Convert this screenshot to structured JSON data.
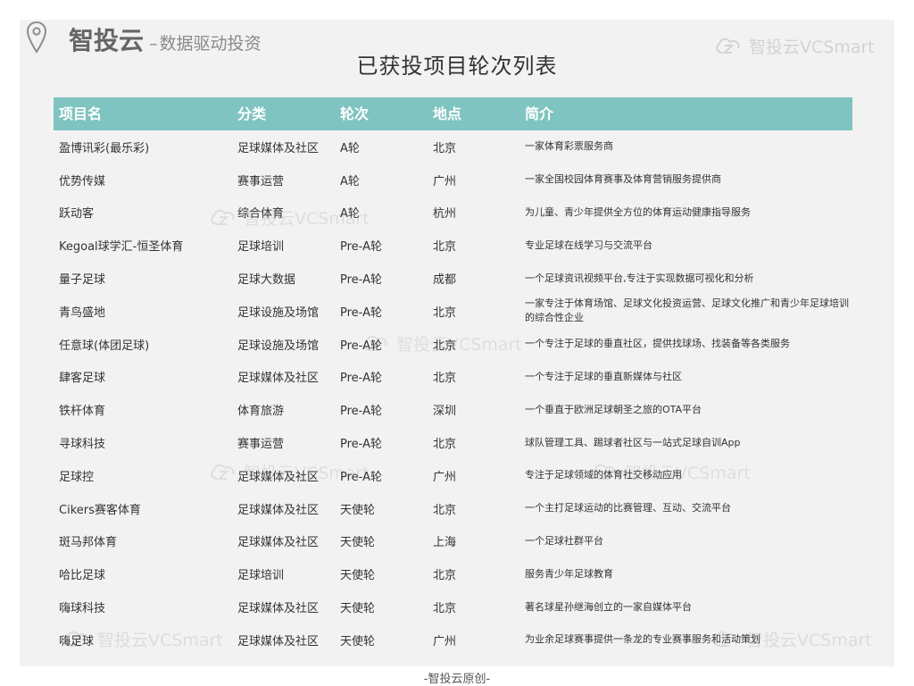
{
  "header": {
    "brand_name": "智投云",
    "brand_dash": "–",
    "brand_tagline": "数据驱动投资",
    "title": "已获投项目轮次列表"
  },
  "watermark": {
    "text": "智投云VCSmart",
    "icon": "vcsmart-logo-icon"
  },
  "table": {
    "columns": [
      "项目名",
      "分类",
      "轮次",
      "地点",
      "简介"
    ],
    "rows": [
      {
        "name": "盈博讯彩(最乐彩)",
        "category": "足球媒体及社区",
        "round": "A轮",
        "city": "北京",
        "intro": "一家体育彩票服务商"
      },
      {
        "name": "优势传媒",
        "category": "赛事运营",
        "round": "A轮",
        "city": "广州",
        "intro": "一家全国校园体育赛事及体育营销服务提供商"
      },
      {
        "name": "跃动客",
        "category": "综合体育",
        "round": "A轮",
        "city": "杭州",
        "intro": "为儿童、青少年提供全方位的体育运动健康指导服务"
      },
      {
        "name": "Kegoal球学汇-恒圣体育",
        "category": "足球培训",
        "round": "Pre-A轮",
        "city": "北京",
        "intro": "专业足球在线学习与交流平台"
      },
      {
        "name": "量子足球",
        "category": "足球大数据",
        "round": "Pre-A轮",
        "city": "成都",
        "intro": "一个足球资讯视频平台,专注于实现数据可视化和分析"
      },
      {
        "name": "青鸟盛地",
        "category": "足球设施及场馆",
        "round": "Pre-A轮",
        "city": "北京",
        "intro": "一家专注于体育场馆、足球文化投资运营、足球文化推广和青少年足球培训的综合性企业"
      },
      {
        "name": "任意球(体团足球)",
        "category": "足球设施及场馆",
        "round": "Pre-A轮",
        "city": "北京",
        "intro": "一个专注于足球的垂直社区，提供找球场、找装备等各类服务"
      },
      {
        "name": "肆客足球",
        "category": "足球媒体及社区",
        "round": "Pre-A轮",
        "city": "北京",
        "intro": "一个专注于足球的垂直新媒体与社区"
      },
      {
        "name": "铁杆体育",
        "category": "体育旅游",
        "round": "Pre-A轮",
        "city": "深圳",
        "intro": "一个垂直于欧洲足球朝圣之旅的OTA平台"
      },
      {
        "name": "寻球科技",
        "category": "赛事运营",
        "round": "Pre-A轮",
        "city": "北京",
        "intro": "球队管理工具、踢球者社区与一站式足球自训App"
      },
      {
        "name": "足球控",
        "category": "足球媒体及社区",
        "round": "Pre-A轮",
        "city": "广州",
        "intro": "专注于足球领域的体育社交移动应用"
      },
      {
        "name": "Cikers赛客体育",
        "category": "足球媒体及社区",
        "round": "天使轮",
        "city": "北京",
        "intro": "一个主打足球运动的比赛管理、互动、交流平台"
      },
      {
        "name": "斑马邦体育",
        "category": "足球媒体及社区",
        "round": "天使轮",
        "city": "上海",
        "intro": "一个足球社群平台"
      },
      {
        "name": "哈比足球",
        "category": "足球培训",
        "round": "天使轮",
        "city": "北京",
        "intro": "服务青少年足球教育"
      },
      {
        "name": "嗨球科技",
        "category": "足球媒体及社区",
        "round": "天使轮",
        "city": "北京",
        "intro": "著名球星孙继海创立的一家自媒体平台"
      },
      {
        "name": "嗨足球",
        "category": "足球媒体及社区",
        "round": "天使轮",
        "city": "广州",
        "intro": "为业余足球赛事提供一条龙的专业赛事服务和活动策划"
      }
    ]
  },
  "footer": {
    "text": "-智投云原创-"
  },
  "colors": {
    "header_bg": "#7fc4c0",
    "slide_bg": "#f2f2f2",
    "text": "#333333"
  }
}
